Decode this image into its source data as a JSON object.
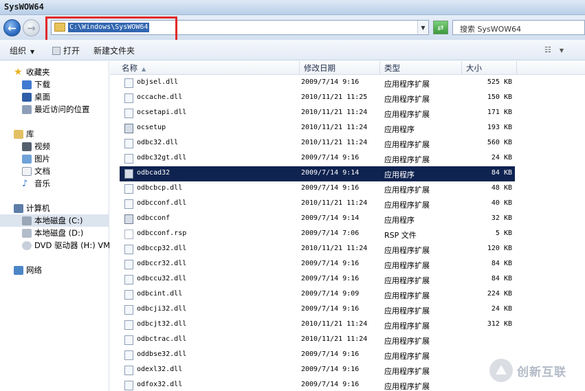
{
  "window": {
    "title": "SysWOW64"
  },
  "address": {
    "path": "C:\\Windows\\SysWOW64",
    "search_placeholder": "搜索 SysWOW64"
  },
  "toolbar": {
    "organize": "组织",
    "open": "打开",
    "new_folder": "新建文件夹"
  },
  "sidebar": {
    "favorites": "收藏夹",
    "downloads": "下载",
    "desktop": "桌面",
    "recent": "最近访问的位置",
    "library": "库",
    "videos": "视频",
    "pictures": "图片",
    "documents": "文档",
    "music": "音乐",
    "computer": "计算机",
    "local_c": "本地磁盘 (C:)",
    "local_d": "本地磁盘 (D:)",
    "dvd": "DVD 驱动器 (H:) VM",
    "network": "网络"
  },
  "columns": {
    "name": "名称",
    "date": "修改日期",
    "type": "类型",
    "size": "大小"
  },
  "files": [
    {
      "name": "objsel.dll",
      "date": "2009/7/14 9:16",
      "type": "应用程序扩展",
      "size": "525 KB",
      "kind": "dll"
    },
    {
      "name": "occache.dll",
      "date": "2010/11/21 11:25",
      "type": "应用程序扩展",
      "size": "150 KB",
      "kind": "dll"
    },
    {
      "name": "ocsetapi.dll",
      "date": "2010/11/21 11:24",
      "type": "应用程序扩展",
      "size": "171 KB",
      "kind": "dll"
    },
    {
      "name": "ocsetup",
      "date": "2010/11/21 11:24",
      "type": "应用程序",
      "size": "193 KB",
      "kind": "app"
    },
    {
      "name": "odbc32.dll",
      "date": "2010/11/21 11:24",
      "type": "应用程序扩展",
      "size": "560 KB",
      "kind": "dll"
    },
    {
      "name": "odbc32gt.dll",
      "date": "2009/7/14 9:16",
      "type": "应用程序扩展",
      "size": "24 KB",
      "kind": "dll"
    },
    {
      "name": "odbcad32",
      "date": "2009/7/14 9:14",
      "type": "应用程序",
      "size": "84 KB",
      "kind": "app",
      "selected": true
    },
    {
      "name": "odbcbcp.dll",
      "date": "2009/7/14 9:16",
      "type": "应用程序扩展",
      "size": "48 KB",
      "kind": "dll"
    },
    {
      "name": "odbcconf.dll",
      "date": "2010/11/21 11:24",
      "type": "应用程序扩展",
      "size": "40 KB",
      "kind": "dll"
    },
    {
      "name": "odbcconf",
      "date": "2009/7/14 9:14",
      "type": "应用程序",
      "size": "32 KB",
      "kind": "app"
    },
    {
      "name": "odbcconf.rsp",
      "date": "2009/7/14 7:06",
      "type": "RSP 文件",
      "size": "5 KB",
      "kind": "rsp"
    },
    {
      "name": "odbccp32.dll",
      "date": "2010/11/21 11:24",
      "type": "应用程序扩展",
      "size": "120 KB",
      "kind": "dll"
    },
    {
      "name": "odbccr32.dll",
      "date": "2009/7/14 9:16",
      "type": "应用程序扩展",
      "size": "84 KB",
      "kind": "dll"
    },
    {
      "name": "odbccu32.dll",
      "date": "2009/7/14 9:16",
      "type": "应用程序扩展",
      "size": "84 KB",
      "kind": "dll"
    },
    {
      "name": "odbcint.dll",
      "date": "2009/7/14 9:09",
      "type": "应用程序扩展",
      "size": "224 KB",
      "kind": "dll"
    },
    {
      "name": "odbcji32.dll",
      "date": "2009/7/14 9:16",
      "type": "应用程序扩展",
      "size": "24 KB",
      "kind": "dll"
    },
    {
      "name": "odbcjt32.dll",
      "date": "2010/11/21 11:24",
      "type": "应用程序扩展",
      "size": "312 KB",
      "kind": "dll"
    },
    {
      "name": "odbctrac.dll",
      "date": "2010/11/21 11:24",
      "type": "应用程序扩展",
      "size": "",
      "kind": "dll"
    },
    {
      "name": "oddbse32.dll",
      "date": "2009/7/14 9:16",
      "type": "应用程序扩展",
      "size": "",
      "kind": "dll"
    },
    {
      "name": "odexl32.dll",
      "date": "2009/7/14 9:16",
      "type": "应用程序扩展",
      "size": "",
      "kind": "dll"
    },
    {
      "name": "odfox32.dll",
      "date": "2009/7/14 9:16",
      "type": "应用程序扩展",
      "size": "",
      "kind": "dll"
    }
  ],
  "watermark": {
    "text": "创新互联"
  }
}
